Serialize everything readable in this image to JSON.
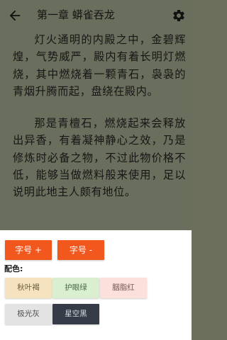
{
  "reader": {
    "background": "#6a6e5c",
    "chapter_title": "第一章 蟒雀吞龙",
    "paragraphs": [
      "灯火通明的内殿之中，金碧辉煌，气势威严，殿内有着长明灯燃烧，其中燃烧着一颗青石，袅袅的青烟升腾而起，盘绕在殿内。",
      "那是青檀石，燃烧起来会释放出异香，有着凝神静心之效，乃是修炼时必备之物，不过此物价格不低，能够当做燃料般来使用，足以说明此地主人颇有地位。"
    ]
  },
  "toolbar": {
    "back_icon": "arrow-left-icon",
    "settings_icon": "gear-icon"
  },
  "settings": {
    "font_increase_label": "字号 +",
    "font_decrease_label": "字号 -",
    "accent": "#f2571e",
    "color_label": "配色:",
    "color_options": [
      {
        "label": "秋叶褐",
        "bg": "#f5e3bf",
        "fg": "#6b5a3a"
      },
      {
        "label": "护眼绿",
        "bg": "#d9efcf",
        "fg": "#4f6b47"
      },
      {
        "label": "胭脂红",
        "bg": "#fbe0dc",
        "fg": "#7a5650"
      },
      {
        "label": "极光灰",
        "bg": "#e3e3e3",
        "fg": "#4e4e4e"
      },
      {
        "label": "星空黑",
        "bg": "#353c48",
        "fg": "#d8dadf"
      }
    ]
  }
}
